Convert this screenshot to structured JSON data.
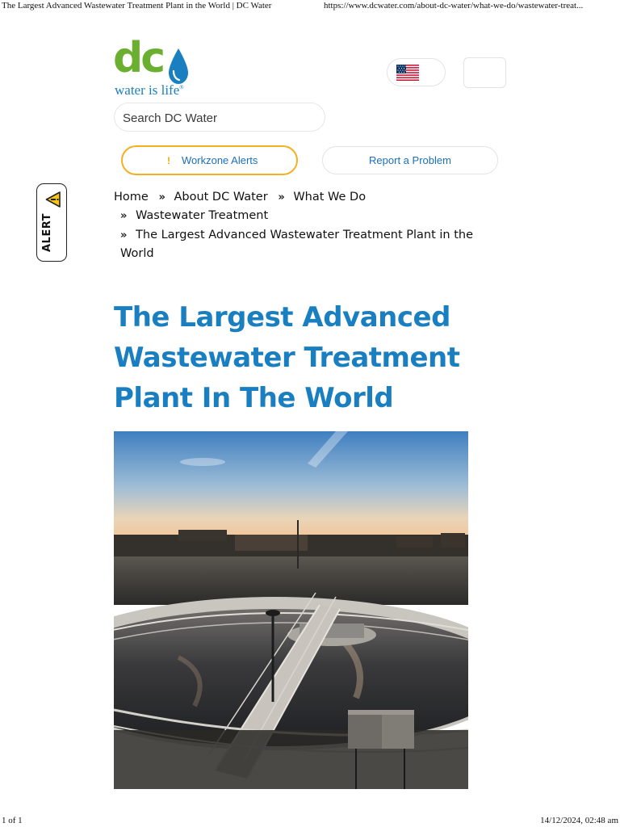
{
  "print": {
    "page_title": "The Largest Advanced Wastewater Treatment Plant in the World | DC Water",
    "url": "https://www.dcwater.com/about-dc-water/what-we-do/wastewater-treat...",
    "page_count": "1 of 1",
    "timestamp": "14/12/2024, 02:48 am"
  },
  "header": {
    "logo_text": "dc",
    "tagline": "water is life",
    "tagline_mark": "®",
    "language_flag": "us-flag-icon",
    "menu_icon": "menu-icon"
  },
  "search": {
    "placeholder": "Search DC Water"
  },
  "actions": {
    "workzone_icon": "!",
    "workzone_label": "Workzone Alerts",
    "report_label": "Report a Problem"
  },
  "alert_tab": {
    "label": "ALERT",
    "icon": "warning-icon"
  },
  "breadcrumb": {
    "separator": "»",
    "items": [
      "Home",
      "About DC Water",
      "What We Do",
      "Wastewater Treatment",
      "The Largest Advanced Wastewater Treatment Plant in the",
      "World"
    ]
  },
  "page": {
    "title_line1": "The Largest Advanced",
    "title_line2": "Wastewater Treatment",
    "title_line3": "Plant In The World"
  },
  "colors": {
    "brand_green": "#6aaf2f",
    "brand_blue": "#1a7fc1",
    "alert_yellow": "#f5b021"
  }
}
